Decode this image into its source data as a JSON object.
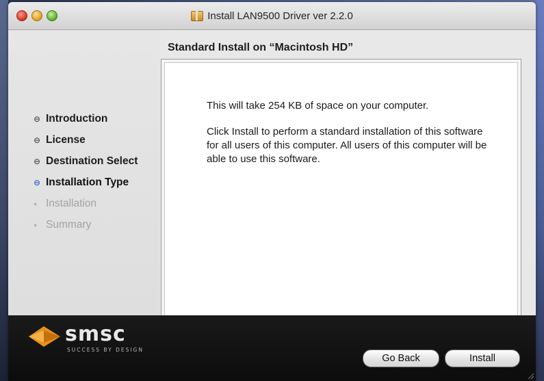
{
  "window": {
    "title": "Install LAN9500 Driver ver 2.2.0"
  },
  "heading": "Standard Install on “Macintosh HD”",
  "steps": [
    {
      "label": "Introduction",
      "state": "completed"
    },
    {
      "label": "License",
      "state": "completed"
    },
    {
      "label": "Destination Select",
      "state": "completed"
    },
    {
      "label": "Installation Type",
      "state": "current"
    },
    {
      "label": "Installation",
      "state": "disabled"
    },
    {
      "label": "Summary",
      "state": "disabled"
    }
  ],
  "content": {
    "size_message": "This will take 254 KB of space on your computer.",
    "detail_message": "Click Install to perform a standard installation of this software for all users of this computer. All users of this computer will be able to use this software."
  },
  "brand": {
    "name": "smsc",
    "tagline": "SUCCESS BY DESIGN",
    "accent": "#e8901c"
  },
  "buttons": {
    "back": "Go Back",
    "install": "Install"
  },
  "icons": {
    "close": "close-button-icon",
    "minimize": "minimize-button-icon",
    "zoom": "zoom-button-icon",
    "package": "package-icon",
    "step_bullet": "step-bullet-icon"
  }
}
